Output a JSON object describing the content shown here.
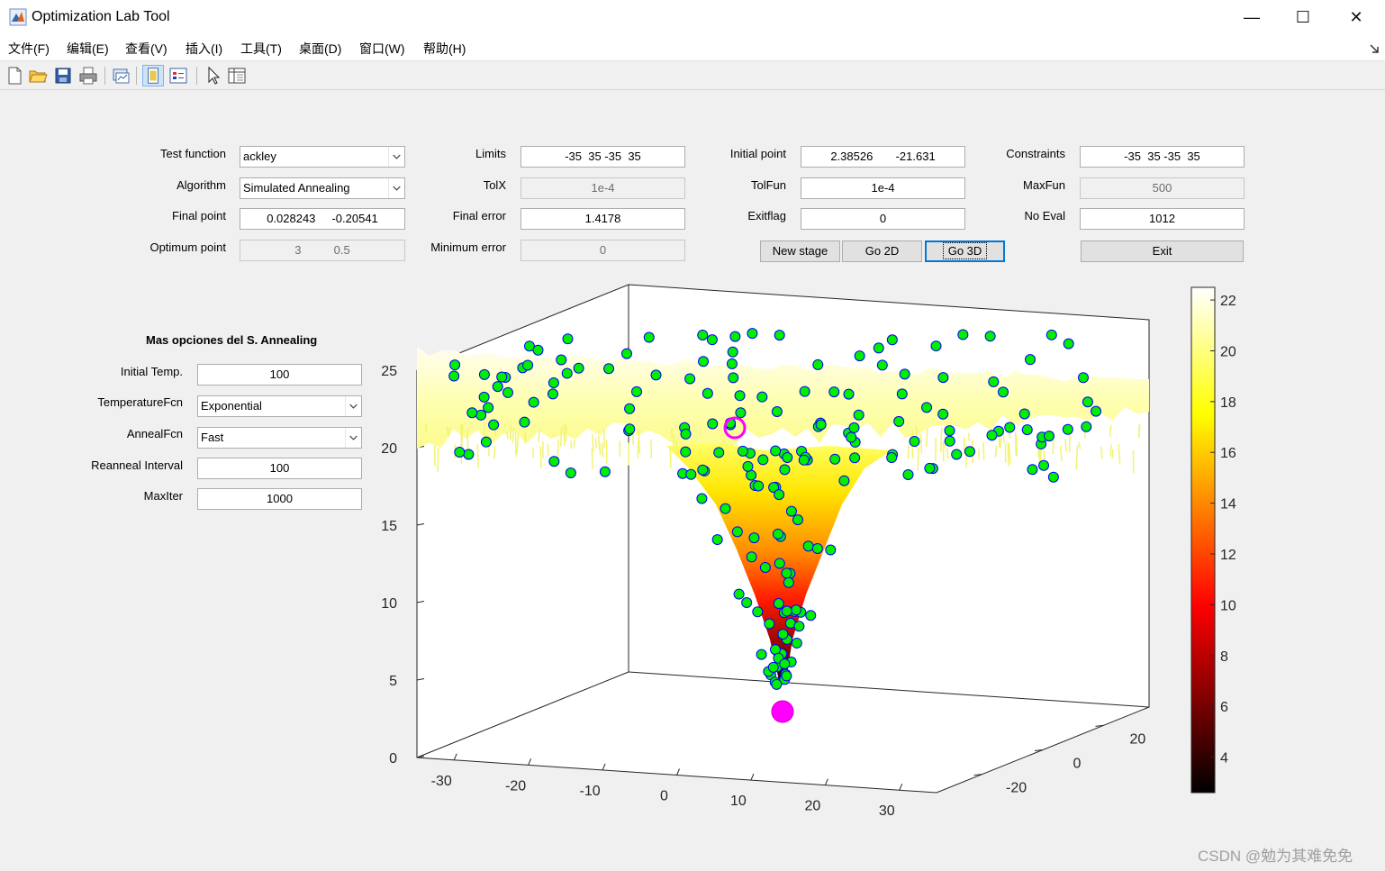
{
  "window": {
    "title": "Optimization Lab Tool",
    "icon": "matlab-icon",
    "controls": [
      "—",
      "☐",
      "✕"
    ]
  },
  "menu": [
    "文件(F)",
    "编辑(E)",
    "查看(V)",
    "插入(I)",
    "工具(T)",
    "桌面(D)",
    "窗口(W)",
    "帮助(H)"
  ],
  "toolbar_icons": [
    "new-figure-icon",
    "open-folder-icon",
    "save-icon",
    "print-icon",
    "link-plot-icon",
    "dock-icon",
    "insert-legend-icon",
    "pointer-icon",
    "property-inspector-icon"
  ],
  "form": {
    "test_function": {
      "label": "Test function",
      "value": "ackley"
    },
    "algorithm": {
      "label": "Algorithm",
      "value": "Simulated Annealing"
    },
    "final_point": {
      "label": "Final point",
      "value": "0.028243     -0.20541"
    },
    "optimum_point": {
      "label": "Optimum point",
      "value": "3          0.5"
    },
    "limits": {
      "label": "Limits",
      "value": "-35  35 -35  35"
    },
    "tolx": {
      "label": "TolX",
      "value": "1e-4"
    },
    "final_error": {
      "label": "Final error",
      "value": "1.4178"
    },
    "minimum_error": {
      "label": "Minimum error",
      "value": "0"
    },
    "initial_point": {
      "label": "Initial point",
      "value": "2.38526       -21.631"
    },
    "tolfun": {
      "label": "TolFun",
      "value": "1e-4"
    },
    "exitflag": {
      "label": "Exitflag",
      "value": "0"
    },
    "constraints": {
      "label": "Constraints",
      "value": "-35  35 -35  35"
    },
    "maxfun": {
      "label": "MaxFun",
      "value": "500"
    },
    "no_eval": {
      "label": "No Eval",
      "value": "1012"
    }
  },
  "buttons": {
    "new_stage": "New stage",
    "go_2d": "Go 2D",
    "go_3d": "Go 3D",
    "exit": "Exit"
  },
  "sa_options": {
    "title": "Mas opciones del S. Annealing",
    "initial_temp": {
      "label": "Initial Temp.",
      "value": "100"
    },
    "temperature_fcn": {
      "label": "TemperatureFcn",
      "value": "Exponential"
    },
    "anneal_fcn": {
      "label": "AnnealFcn",
      "value": "Fast"
    },
    "reanneal_interval": {
      "label": "Reanneal Interval",
      "value": "100"
    },
    "maxiter": {
      "label": "MaxIter",
      "value": "1000"
    }
  },
  "chart_data": {
    "type": "surface",
    "title": "",
    "xlabel": "",
    "ylabel": "",
    "zlabel": "",
    "xlim": [
      -35,
      35
    ],
    "ylim": [
      -35,
      35
    ],
    "zlim": [
      0,
      25
    ],
    "x_ticks": [
      -30,
      -20,
      -10,
      0,
      10,
      20,
      30
    ],
    "y_ticks": [
      -20,
      0,
      20
    ],
    "z_ticks": [
      0,
      5,
      10,
      15,
      20,
      25
    ],
    "colorbar": {
      "ticks": [
        4,
        6,
        8,
        10,
        12,
        14,
        16,
        18,
        20,
        22
      ],
      "range": [
        2.6,
        22.5
      ],
      "colormap": "hot"
    },
    "marker_colors": {
      "evaluated": "#00ee00",
      "edge": "#0000ff",
      "initial_final": "#ff00ff"
    },
    "start_point": [
      2.38526,
      -21.631
    ],
    "final_point": [
      0.028243,
      -0.20541
    ],
    "optimum_point": [
      3,
      0.5
    ]
  },
  "watermark": "CSDN @勉为其难免免"
}
